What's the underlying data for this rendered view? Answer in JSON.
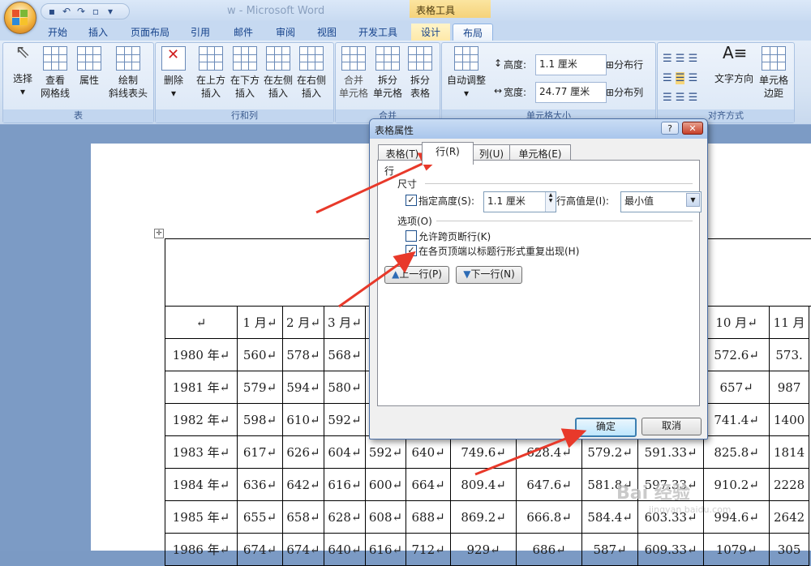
{
  "window": {
    "title": "w - Microsoft Word",
    "context_group": "表格工具",
    "qat_icons": [
      "save-icon",
      "undo-icon",
      "redo-icon",
      "print-preview-icon",
      "customize-icon"
    ]
  },
  "tabs": [
    "开始",
    "插入",
    "页面布局",
    "引用",
    "邮件",
    "审阅",
    "视图",
    "开发工具",
    "设计",
    "布局"
  ],
  "active_tab": "布局",
  "ribbon": {
    "groups": [
      {
        "label": "表",
        "buttons": [
          {
            "label": "选择",
            "sub": "▾"
          },
          {
            "label": "查看",
            "sub": "网格线"
          },
          {
            "label": "属性",
            "sub": ""
          },
          {
            "label": "绘制",
            "sub": "斜线表头"
          }
        ]
      },
      {
        "label": "行和列",
        "buttons": [
          {
            "label": "删除",
            "sub": "▾"
          },
          {
            "label": "在上方",
            "sub": "插入"
          },
          {
            "label": "在下方",
            "sub": "插入"
          },
          {
            "label": "在左侧",
            "sub": "插入"
          },
          {
            "label": "在右侧",
            "sub": "插入"
          }
        ]
      },
      {
        "label": "合并",
        "buttons": [
          {
            "label": "合并",
            "sub": "单元格"
          },
          {
            "label": "拆分",
            "sub": "单元格"
          },
          {
            "label": "拆分",
            "sub": "表格"
          }
        ]
      },
      {
        "label": "单元格大小",
        "buttons": [
          {
            "label": "自动调整",
            "sub": "▾"
          }
        ]
      },
      {
        "label": "对齐方式",
        "buttons": [
          {
            "label": "文字方向",
            "sub": ""
          },
          {
            "label": "单元格",
            "sub": "边距"
          }
        ]
      }
    ],
    "cell_size": {
      "height_label": "高度:",
      "height_value": "1.1 厘米",
      "width_label": "宽度:",
      "width_value": "24.77 厘米",
      "distribute_rows": "分布行",
      "distribute_cols": "分布列"
    }
  },
  "dialog": {
    "title": "表格属性",
    "help": "?",
    "close": "✕",
    "tabs": [
      "表格(T)",
      "行(R)",
      "列(U)",
      "单元格(E)"
    ],
    "active_tab": "行(R)",
    "section_row": "行",
    "section_size": "尺寸",
    "specify_height": {
      "label": "指定高度(S):",
      "checked": true,
      "value": "1.1 厘米"
    },
    "row_height_is": {
      "label": "行高值是(I):",
      "value": "最小值"
    },
    "section_options": "选项(O)",
    "allow_break": {
      "label": "允许跨页断行(K)",
      "checked": false
    },
    "repeat_header": {
      "label": "在各页顶端以标题行形式重复出现(H)",
      "checked": true
    },
    "prev_row": "上一行(P)",
    "next_row": "下一行(N)",
    "ok": "确定",
    "cancel": "取消"
  },
  "table": {
    "header": [
      "↵",
      "1 月↵",
      "2 月↵",
      "3 月↵",
      "",
      "",
      "",
      "",
      "",
      "",
      "10 月↵",
      "11 月"
    ],
    "rows": [
      [
        "1980 年↵",
        "560↵",
        "578↵",
        "568↵",
        "",
        "",
        "",
        "",
        "",
        "",
        "572.6↵",
        "573."
      ],
      [
        "1981 年↵",
        "579↵",
        "594↵",
        "580↵",
        "",
        "",
        "",
        "",
        "",
        "",
        "657↵",
        "987"
      ],
      [
        "1982 年↵",
        "598↵",
        "610↵",
        "592↵",
        "",
        "",
        "",
        "",
        "",
        "",
        "741.4↵",
        "1400"
      ],
      [
        "1983 年↵",
        "617↵",
        "626↵",
        "604↵",
        "592↵",
        "640↵",
        "749.6↵",
        "628.4↵",
        "579.2↵",
        "591.33↵",
        "825.8↵",
        "1814"
      ],
      [
        "1984 年↵",
        "636↵",
        "642↵",
        "616↵",
        "600↵",
        "664↵",
        "809.4↵",
        "647.6↵",
        "581.8↵",
        "597.33↵",
        "910.2↵",
        "2228"
      ],
      [
        "1985 年↵",
        "655↵",
        "658↵",
        "628↵",
        "608↵",
        "688↵",
        "869.2↵",
        "666.8↵",
        "584.4↵",
        "603.33↵",
        "994.6↵",
        "2642"
      ],
      [
        "1986 年↵",
        "674↵",
        "674↵",
        "640↵",
        "616↵",
        "712↵",
        "929↵",
        "686↵",
        "587↵",
        "609.33↵",
        "1079↵",
        "305"
      ]
    ]
  },
  "watermark": {
    "text": "Bai 经验",
    "sub": "jingyan.baidu.com"
  }
}
